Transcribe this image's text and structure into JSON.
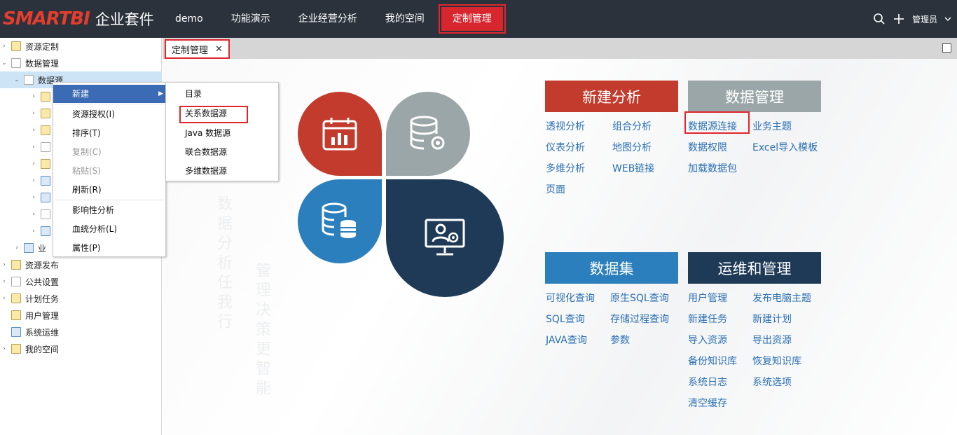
{
  "header": {
    "brand": "SMARTBI",
    "suite": "企业套件",
    "nav": [
      "demo",
      "功能演示",
      "企业经营分析",
      "我的空间",
      "定制管理"
    ],
    "active_nav": "定制管理",
    "user": "管理员"
  },
  "tree": {
    "items": [
      {
        "label": "资源定制"
      },
      {
        "label": "数据管理"
      },
      {
        "label": "数据源"
      },
      {
        "label": "业"
      },
      {
        "label": "资源发布"
      },
      {
        "label": "公共设置"
      },
      {
        "label": "计划任务"
      },
      {
        "label": "用户管理"
      },
      {
        "label": "系统运维"
      },
      {
        "label": "我的空间"
      }
    ]
  },
  "context_menu": {
    "items": [
      "新建",
      "资源授权(I)",
      "排序(T)",
      "复制(C)",
      "粘贴(S)",
      "刷新(R)",
      "影响性分析",
      "血统分析(L)",
      "属性(P)"
    ]
  },
  "submenu": {
    "items": [
      "目录",
      "关系数据源",
      "Java 数据源",
      "联合数据源",
      "多维数据源"
    ]
  },
  "tab": {
    "label": "定制管理",
    "close": "✕"
  },
  "watermark": {
    "line1": "数据分析任我行",
    "line2": "管理决策更智能"
  },
  "sections": {
    "new_analysis": {
      "title": "新建分析",
      "links": [
        "透视分析",
        "组合分析",
        "仪表分析",
        "地图分析",
        "多维分析",
        "WEB链接",
        "页面"
      ]
    },
    "data_mgmt": {
      "title": "数据管理",
      "links": [
        "数据源连接",
        "业务主题",
        "数据权限",
        "Excel导入模板",
        "加载数据包"
      ]
    },
    "dataset": {
      "title": "数据集",
      "links": [
        "可视化查询",
        "原生SQL查询",
        "SQL查询",
        "存储过程查询",
        "JAVA查询",
        "参数"
      ]
    },
    "ops": {
      "title": "运维和管理",
      "links": [
        "用户管理",
        "发布电脑主题",
        "新建任务",
        "新建计划",
        "导入资源",
        "导出资源",
        "备份知识库",
        "恢复知识库",
        "系统日志",
        "系统选项",
        "清空缓存"
      ]
    }
  },
  "colors": {
    "topbar": "#2b323c",
    "red": "#c23b2c",
    "gray": "#9aa6a7",
    "blue": "#2c7fbd",
    "navy": "#1e3a57",
    "link": "#2a6fb4",
    "highlight": "#e0262d"
  }
}
